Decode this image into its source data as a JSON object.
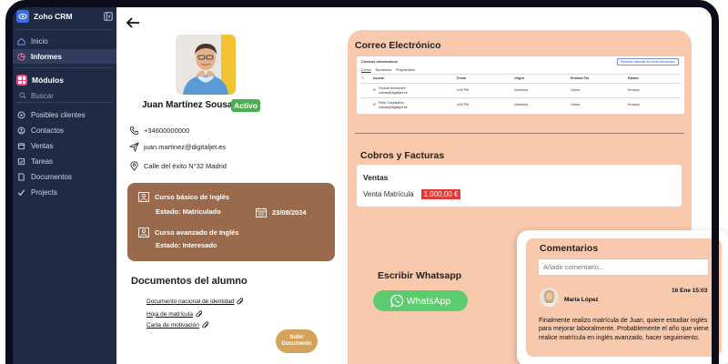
{
  "sidebar": {
    "brand": "Zoho CRM",
    "items_top": [
      {
        "label": "Inicio",
        "icon": "home-icon"
      },
      {
        "label": "Informes",
        "icon": "reports-icon"
      }
    ],
    "modules_label": "Módulos",
    "search_placeholder": "Buscar",
    "items": [
      {
        "label": "Posibles clientes",
        "icon": "leads-icon"
      },
      {
        "label": "Contactos",
        "icon": "contacts-icon"
      },
      {
        "label": "Ventas",
        "icon": "sales-icon"
      },
      {
        "label": "Tareas",
        "icon": "tasks-icon"
      },
      {
        "label": "Documentos",
        "icon": "documents-icon"
      },
      {
        "label": "Projects",
        "icon": "projects-icon"
      }
    ]
  },
  "profile": {
    "name": "Juan Martínez Sousa",
    "status": "Activo",
    "phone": "+34600000000",
    "email": "juan.martinez@digitaljet.es",
    "address": "Calle del éxito N°32 Madrid"
  },
  "courses": [
    {
      "title": "Curso básico de Inglés",
      "status": "Estado: Matriculado",
      "date": "23/08/2024"
    },
    {
      "title": "Curso avanzado de Inglés",
      "status": "Estado: Interesado"
    }
  ],
  "documents": {
    "title": "Documentos del alumno",
    "items": [
      "Documento nacional de identidad",
      "Hoja de matrícula",
      "Carta de motivación"
    ],
    "upload_label_1": "Subir",
    "upload_label_2": "Documento"
  },
  "email": {
    "title": "Correo Electrónico",
    "card_title": "Correos electrónicos",
    "card_button": "Redactar mensaje de correo electrónico",
    "tabs": [
      "Correo",
      "Borradores",
      "Programados"
    ],
    "headers": [
      "Asunto",
      "Fecha",
      "Origen",
      "Enviado Por",
      "Estado"
    ],
    "rows": [
      {
        "subject": "Factura Noviembre",
        "address": "cuenta@digitaljet.es",
        "date": "6:00 PM",
        "origin": "Individual",
        "sent_by": "Carlos",
        "status": "Enviado"
      },
      {
        "subject": "Feliz Cumpleaños",
        "address": "cuenta@digitaljet.es",
        "date": "6:00 PM",
        "origin": "Individual",
        "sent_by": "Carlos",
        "status": "Enviado"
      }
    ]
  },
  "billing": {
    "title": "Cobros y Facturas",
    "ventas_label": "Ventas",
    "sale_label": "Venta Matrícula",
    "sale_amount": "1.000,00 €"
  },
  "whatsapp": {
    "title": "Escribir Whatsapp",
    "button_label": "WhatsApp"
  },
  "comments": {
    "title": "Comentarios",
    "placeholder": "Añadir comentario...",
    "author": "María López",
    "date": "16 Ene 15:03",
    "text": "Finalmente realizo matrícula de Juan, quiere estudiar inglés para mejorar laboralmente. Probablemente el año que viene realice matrícula en inglés avanzado, hacer seguimiento."
  },
  "colors": {
    "sidebar": "#1f2a44",
    "accent_panel": "#f8c9ad",
    "course_card": "#9a6a4c",
    "status_green": "#4caf50",
    "whatsapp_green": "#5dcc6e",
    "amount_red": "#e53935",
    "upload_gold": "#d5a25a"
  }
}
